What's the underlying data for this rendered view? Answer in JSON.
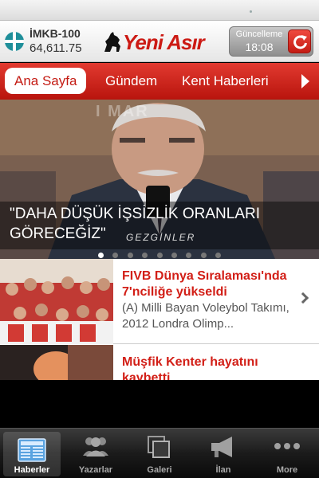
{
  "header": {
    "index_name": "İMKB-100",
    "index_value": "64,611.75",
    "logo_text": "Yeni Asır",
    "refresh_label": "Güncelleme",
    "refresh_time": "18:08"
  },
  "tabs": [
    {
      "label": "Ana Sayfa",
      "active": true
    },
    {
      "label": "Gündem",
      "active": false
    },
    {
      "label": "Kent Haberleri",
      "active": false
    }
  ],
  "hero": {
    "headline": "\"DAHA DÜŞÜK İŞSİZLİK ORANLARI GÖRECEĞİZ\"",
    "watermark": "GEZGİNLER",
    "slide_count": 9,
    "active_slide": 1
  },
  "news": [
    {
      "title": "FIVB Dünya Sıralaması'nda 7'nciliğe yükseldi",
      "summary": "(A) Milli Bayan Voleybol Takımı, 2012 Londra   Olimp..."
    },
    {
      "title": "Müşfik Kenter hayatını kaybetti",
      "summary": ""
    }
  ],
  "bottom_tabs": [
    {
      "label": "Haberler",
      "icon": "newspaper-icon",
      "active": true
    },
    {
      "label": "Yazarlar",
      "icon": "people-icon",
      "active": false
    },
    {
      "label": "Galeri",
      "icon": "gallery-icon",
      "active": false
    },
    {
      "label": "İlan",
      "icon": "megaphone-icon",
      "active": false
    },
    {
      "label": "More",
      "icon": "more-dots-icon",
      "active": false
    }
  ],
  "colors": {
    "brand_red": "#cc1a14",
    "tab_bar": "#c41c14",
    "headline_red": "#d21e16"
  }
}
